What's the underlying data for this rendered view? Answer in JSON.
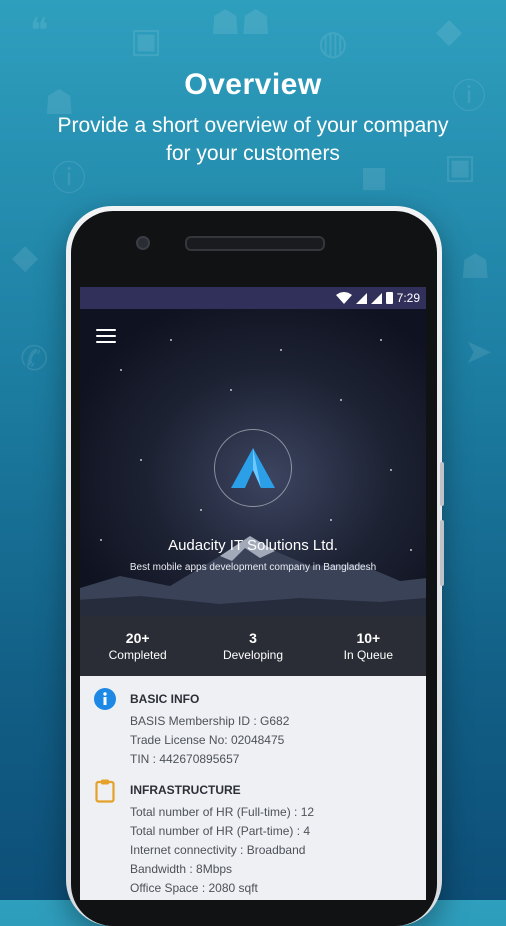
{
  "header": {
    "title": "Overview",
    "subtitle_line1": "Provide a short overview of your company",
    "subtitle_line2": "for your customers"
  },
  "status_bar": {
    "time": "7:29"
  },
  "company": {
    "name": "Audacity IT Solutions Ltd.",
    "tagline": "Best mobile apps development company in Bangladesh"
  },
  "stats": [
    {
      "value": "20+",
      "label": "Completed"
    },
    {
      "value": "3",
      "label": "Developing"
    },
    {
      "value": "10+",
      "label": "In Queue"
    }
  ],
  "basic_info": {
    "title": "BASIC INFO",
    "lines": [
      "BASIS Membership ID : G682",
      "Trade License No: 02048475",
      "TIN : 442670895657"
    ]
  },
  "infrastructure": {
    "title": "INFRASTRUCTURE",
    "lines": [
      "Total number of HR (Full-time) : 12",
      "Total number of HR (Part-time) : 4",
      "Internet connectivity : Broadband",
      "Bandwidth : 8Mbps",
      "Office Space : 2080 sqft"
    ]
  },
  "colors": {
    "accent_blue": "#1e88e5",
    "status_bar": "#30305a",
    "stats_bar": "#2a2d35",
    "infra_icon": "#e5a12a"
  },
  "icons": [
    "menu-icon",
    "info-icon",
    "clipboard-icon",
    "wifi-icon",
    "signal-icon",
    "battery-icon",
    "company-logo-icon"
  ]
}
